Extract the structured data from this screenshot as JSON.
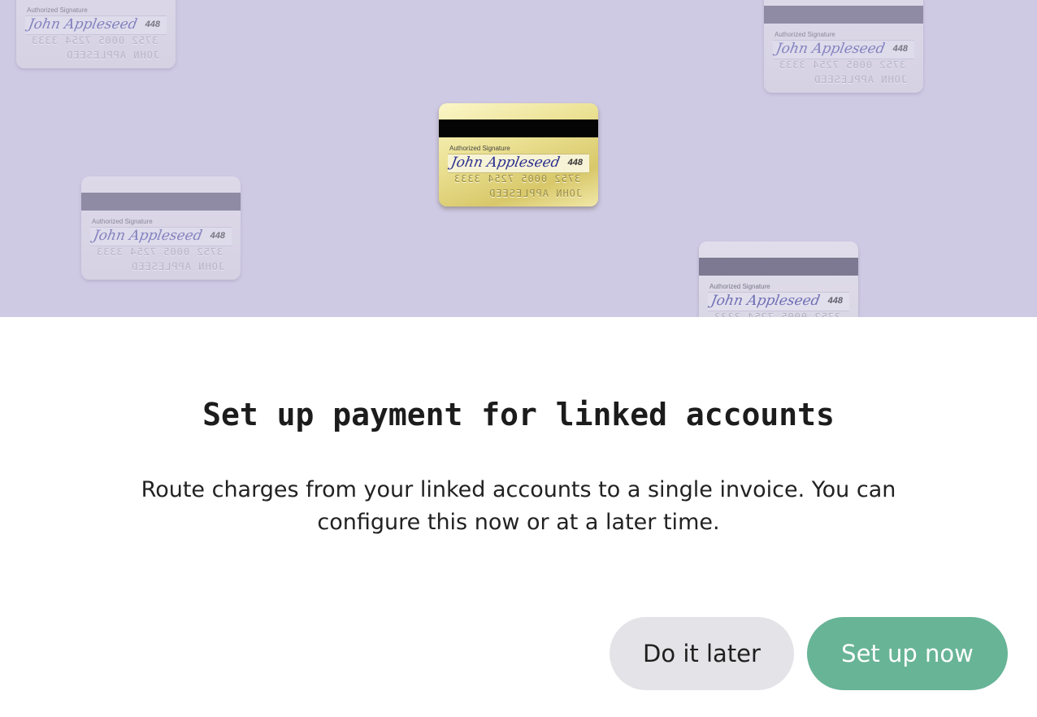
{
  "hero": {
    "background_color": "#cfcae4",
    "card": {
      "authorized_label": "Authorized Signature",
      "signature": "John Appleseed",
      "cvv": "448",
      "embossed_number": "3752 0005 7254 3333",
      "embossed_name": "JOHN APPLESEED"
    }
  },
  "dialog": {
    "title": "Set up payment for linked accounts",
    "description": "Route charges from your linked accounts to a single invoice. You can configure this now or at a later time.",
    "secondary_button": "Do it later",
    "primary_button": "Set up now",
    "primary_color": "#68b496",
    "secondary_color": "#e3e3e8"
  }
}
